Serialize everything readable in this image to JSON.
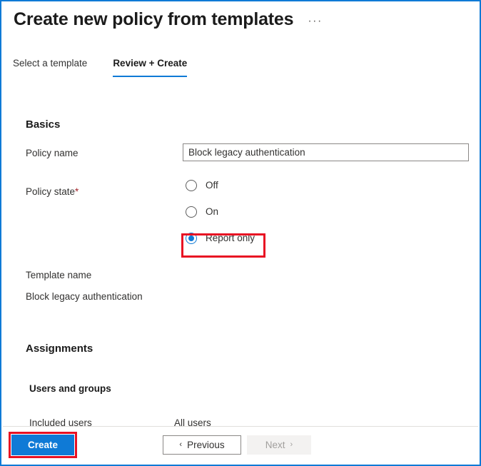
{
  "window": {
    "border_color": "#0f7ad6",
    "accent_color": "#0078d4",
    "annotation_color": "#e81123"
  },
  "header": {
    "title": "Create new policy from templates",
    "more_options": "···"
  },
  "tabs": [
    {
      "label": "Select a template",
      "active": false
    },
    {
      "label": "Review + Create",
      "active": true
    }
  ],
  "basics": {
    "section_title": "Basics",
    "policy_name": {
      "label": "Policy name",
      "value": "Block legacy authentication",
      "placeholder": "Policy name"
    },
    "policy_state": {
      "label": "Policy state",
      "required_marker": "*",
      "options": [
        {
          "label": "Off",
          "checked": false
        },
        {
          "label": "On",
          "checked": false
        },
        {
          "label": "Report only",
          "checked": true
        }
      ]
    },
    "template_name": {
      "label": "Template name",
      "value": "Block legacy authentication"
    }
  },
  "assignments": {
    "section_title": "Assignments",
    "users_and_groups": {
      "title": "Users and groups",
      "rows": [
        {
          "label": "Included users",
          "value": "All users"
        }
      ]
    }
  },
  "footer": {
    "create_label": "Create",
    "previous_label": "Previous",
    "next_label": "Next",
    "previous_chevron": "‹",
    "next_chevron": "›"
  }
}
